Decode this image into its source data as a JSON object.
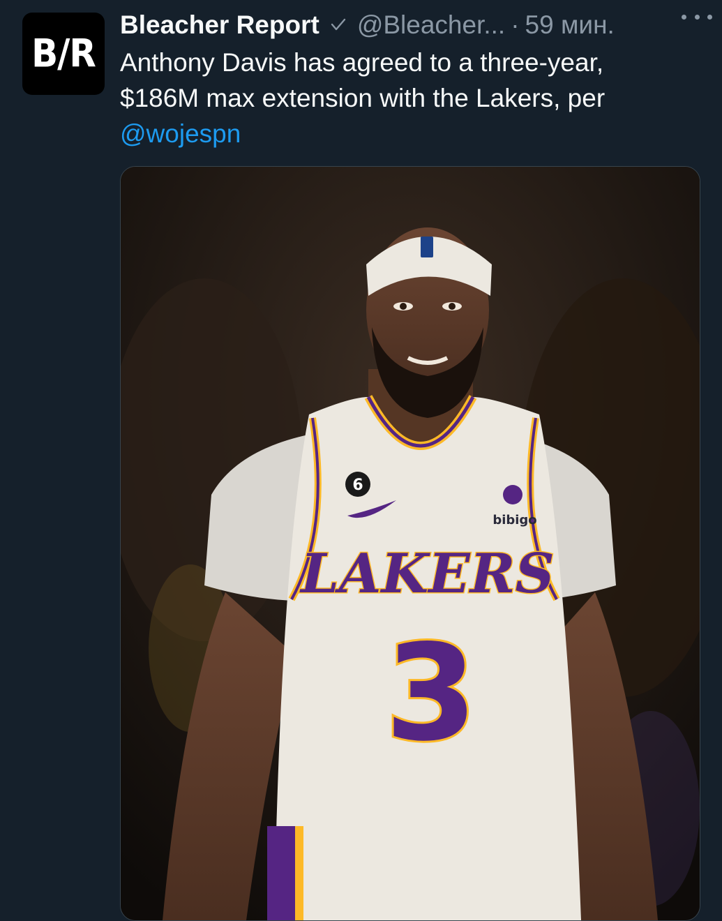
{
  "tweet": {
    "author": {
      "avatar_text": "B/R",
      "name": "Bleacher Report",
      "handle": "@Bleacher...",
      "separator": "·",
      "time": "59 мин."
    },
    "text": {
      "line1": "Anthony Davis has agreed to a three-year,",
      "line2": "$186M max extension with the Lakers, per",
      "mention": "@wojespn"
    },
    "media": {
      "jersey_wordmark": "LAKERS",
      "jersey_number": "3",
      "patch_number": "6",
      "sponsor": "bibigo"
    }
  },
  "colors": {
    "background": "#15202b",
    "link": "#1d9bf0",
    "muted": "#8b98a5",
    "lakers_purple": "#552583",
    "lakers_gold": "#fdb927"
  },
  "icons": [
    "verified-icon",
    "more-icon"
  ]
}
